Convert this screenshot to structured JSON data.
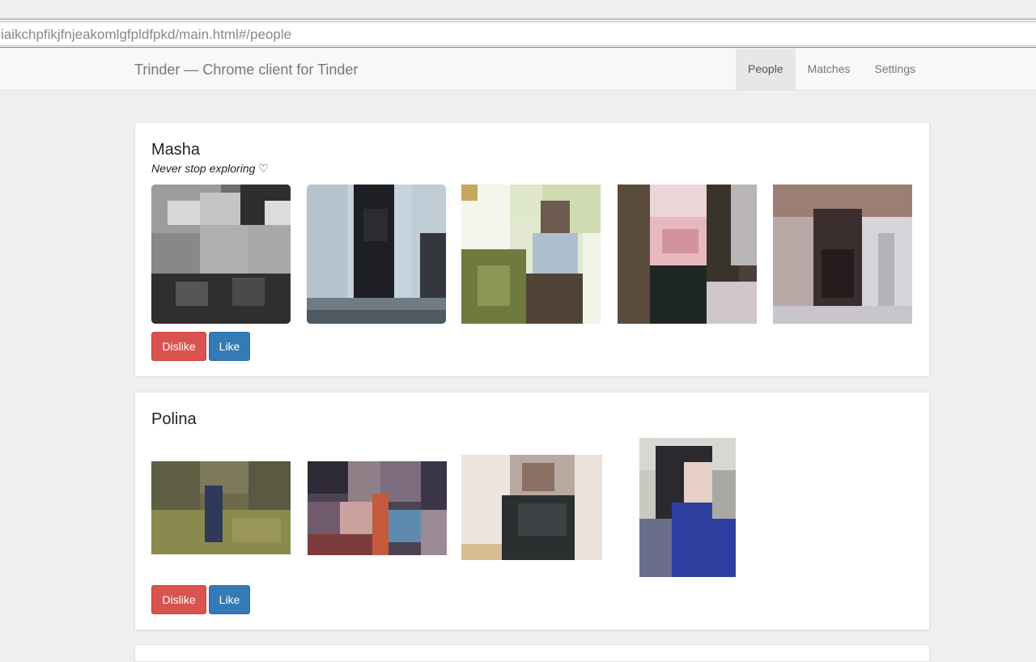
{
  "browser": {
    "url": "iaikchpfikjfnjeakomlgfpldfpkd/main.html#/people"
  },
  "navbar": {
    "brand": "Trinder — Chrome client for Tinder",
    "items": [
      {
        "label": "People",
        "active": true
      },
      {
        "label": "Matches",
        "active": false
      },
      {
        "label": "Settings",
        "active": false
      }
    ]
  },
  "people": [
    {
      "name": "Masha",
      "bio": "Never stop exploring ♡",
      "photo_count": 5,
      "dislike_label": "Dislike",
      "like_label": "Like"
    },
    {
      "name": "Polina",
      "bio": "",
      "photo_count": 4,
      "dislike_label": "Dislike",
      "like_label": "Like"
    }
  ],
  "colors": {
    "dislike": "#d9534f",
    "like": "#337ab7",
    "navbar_bg": "#f8f8f8",
    "page_bg": "#efefef"
  }
}
